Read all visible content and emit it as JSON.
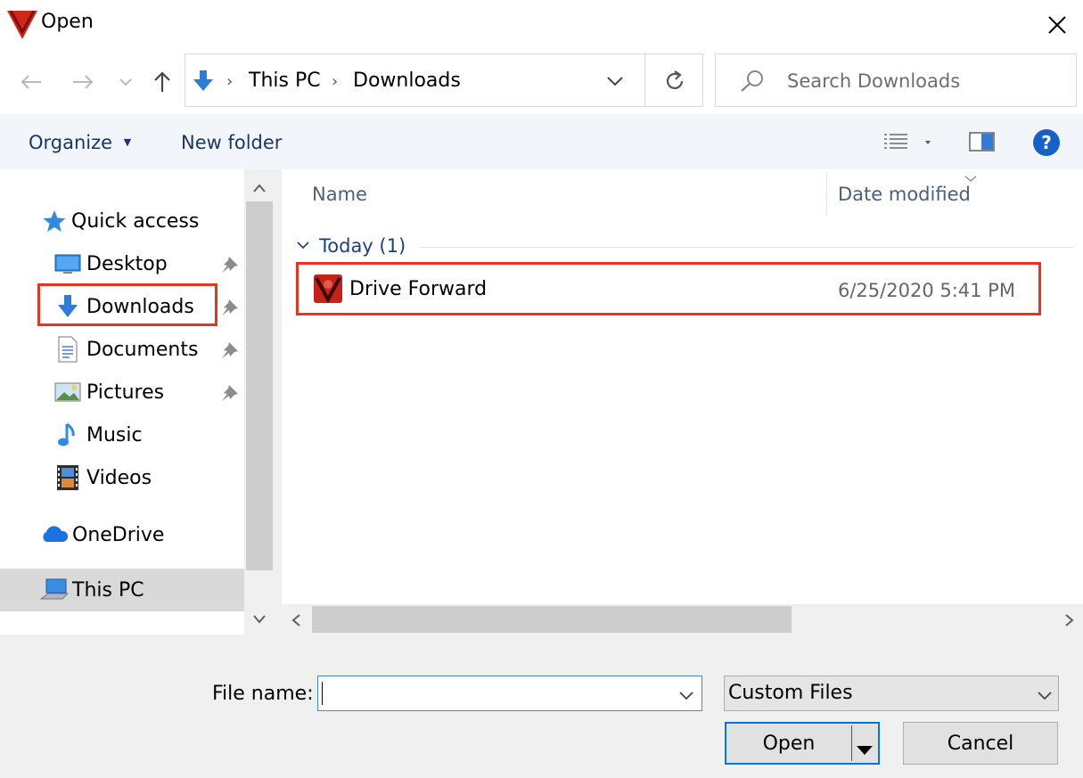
{
  "window": {
    "title": "Open"
  },
  "address": {
    "crumbs": [
      "This PC",
      "Downloads"
    ]
  },
  "search": {
    "placeholder": "Search Downloads"
  },
  "toolbar": {
    "organize": "Organize",
    "new_folder": "New folder"
  },
  "sidebar": {
    "quick_access": "Quick access",
    "items": [
      {
        "label": "Desktop",
        "icon": "desktop-icon"
      },
      {
        "label": "Downloads",
        "icon": "downloads-icon"
      },
      {
        "label": "Documents",
        "icon": "documents-icon"
      },
      {
        "label": "Pictures",
        "icon": "pictures-icon"
      },
      {
        "label": "Music",
        "icon": "music-icon"
      },
      {
        "label": "Videos",
        "icon": "videos-icon"
      }
    ],
    "onedrive": "OneDrive",
    "this_pc": "This PC"
  },
  "columns": {
    "name": "Name",
    "date_modified": "Date modified"
  },
  "groups": [
    {
      "label": "Today (1)",
      "files": [
        {
          "name": "Drive Forward",
          "date": "6/25/2020 5:41 PM"
        }
      ]
    }
  ],
  "footer": {
    "file_name_label": "File name:",
    "file_name_value": "",
    "file_type": "Custom Files",
    "open": "Open",
    "cancel": "Cancel"
  },
  "colors": {
    "highlight": "#e8341c",
    "accent": "#2f7bd6",
    "selected_nav": "#d9d9d9"
  }
}
